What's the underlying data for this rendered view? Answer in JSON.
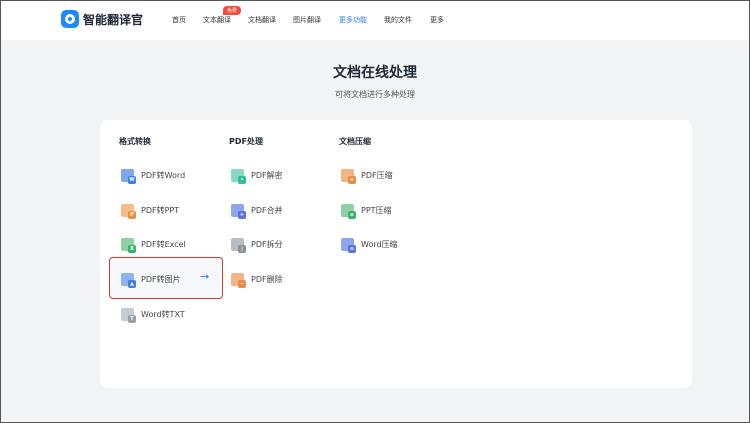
{
  "header": {
    "brand": "智能翻译官",
    "nav": [
      {
        "label": "首页"
      },
      {
        "label": "文本翻译",
        "badge": "免费"
      },
      {
        "label": "文档翻译"
      },
      {
        "label": "图片翻译"
      },
      {
        "label": "更多功能",
        "active": true
      },
      {
        "label": "我的文件"
      },
      {
        "label": "更多"
      }
    ]
  },
  "hero": {
    "title": "文档在线处理",
    "subtitle": "可将文档进行多种处理"
  },
  "columns": [
    {
      "title": "格式转换",
      "items": [
        {
          "label": "PDF转Word",
          "icon": "word-doc-icon",
          "color": "#7fa9ea",
          "accent": "#3f7fe0",
          "glyph": "W"
        },
        {
          "label": "PDF转PPT",
          "icon": "ppt-doc-icon",
          "color": "#f3bd84",
          "accent": "#ec8f3a",
          "glyph": "P"
        },
        {
          "label": "PDF转Excel",
          "icon": "excel-doc-icon",
          "color": "#8fd0a5",
          "accent": "#39b26a",
          "glyph": "X"
        },
        {
          "label": "PDF转图片",
          "icon": "image-doc-icon",
          "color": "#8fb3ee",
          "accent": "#3f7fe0",
          "glyph": "▲",
          "selected": true
        },
        {
          "label": "Word转TXT",
          "icon": "txt-doc-icon",
          "color": "#c8ccd3",
          "accent": "#9aa0a8",
          "glyph": "T"
        }
      ]
    },
    {
      "title": "PDF处理",
      "items": [
        {
          "label": "PDF解密",
          "icon": "unlock-doc-icon",
          "color": "#8ad7c4",
          "accent": "#35b99a",
          "glyph": "•"
        },
        {
          "label": "PDF合并",
          "icon": "merge-doc-icon",
          "color": "#8fa6ee",
          "accent": "#5a73de",
          "glyph": "+"
        },
        {
          "label": "PDF拆分",
          "icon": "split-doc-icon",
          "color": "#b8bcc4",
          "accent": "#8b9099",
          "glyph": "|"
        },
        {
          "label": "PDF删除",
          "icon": "delete-doc-icon",
          "color": "#f2b486",
          "accent": "#e98a45",
          "glyph": "−"
        }
      ]
    },
    {
      "title": "文档压缩",
      "items": [
        {
          "label": "PDF压缩",
          "icon": "pdf-compress-icon",
          "color": "#f2b486",
          "accent": "#e98a45",
          "glyph": "≡"
        },
        {
          "label": "PPT压缩",
          "icon": "ppt-compress-icon",
          "color": "#8fd0a5",
          "accent": "#39b26a",
          "glyph": "≡"
        },
        {
          "label": "Word压缩",
          "icon": "word-compress-icon",
          "color": "#8fa6ee",
          "accent": "#5a73de",
          "glyph": "≡"
        }
      ]
    }
  ],
  "selected_action": {
    "icon": "arrow-right-icon",
    "glyph": "→"
  }
}
